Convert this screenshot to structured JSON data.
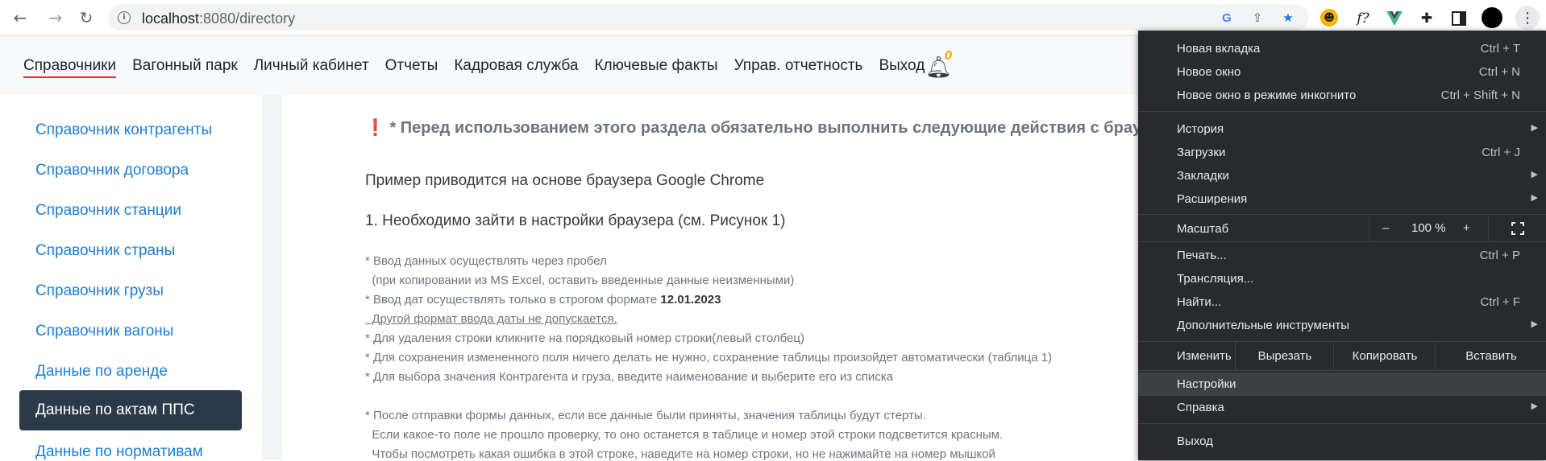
{
  "browser": {
    "url_host": "localhost",
    "url_path": ":8080/directory",
    "nav": {
      "back": "←",
      "forward": "→",
      "reload": "↻"
    },
    "omnibox_icons": [
      "google-icon",
      "share-icon",
      "star-icon"
    ],
    "extension_icons": [
      "ext-face-icon",
      "ext-function-icon",
      "ext-vue-icon",
      "puzzle-icon",
      "sidepanel-icon",
      "profile-avatar",
      "kebab-menu-icon"
    ],
    "ext_function_label": "f?"
  },
  "site": {
    "nav": [
      "Справочники",
      "Вагонный парк",
      "Личный кабинет",
      "Отчеты",
      "Кадровая служба",
      "Ключевые факты",
      "Управ. отчетность",
      "Выход"
    ],
    "active_nav": "Справочники",
    "notifications_count": "0"
  },
  "sidebar": {
    "items": [
      "Справочник контрагенты",
      "Справочник договора",
      "Справочник станции",
      "Справочник страны",
      "Справочник грузы",
      "Справочник вагоны",
      "Данные по аренде",
      "Данные по актам ППС",
      "Данные по нормативам"
    ],
    "active": "Данные по актам ППС"
  },
  "content": {
    "warning_mark": "❗",
    "warning": "* Перед использованием этого раздела обязательно выполнить следующие действия с браузером",
    "example": "Пример приводится на основе браузера Google Chrome",
    "step1": "1. Необходимо зайти в настройки браузера (см. Рисунок 1)",
    "notes": [
      "* Ввод данных осуществлять через пробел",
      "  (при копировании из MS Excel, оставить введенные данные неизменными)",
      "* Ввод дат осуществлять только в строгом формате ",
      "  Другой формат ввода даты не допускается.",
      "* Для удаления строки кликните на порядковый номер строки(левый столбец)",
      "* Для сохранения измененного поля ничего делать не нужно, сохранение таблицы произойдет автоматически (таблица 1)",
      "* Для выбора значения Контрагента и груза, введите наименование и выберите его из списка",
      "* После отправки формы данных, если все данные были приняты, значения таблицы будут стерты.",
      "  Если какое-то поле не прошло проверку, то оно останется в таблице и номер этой строки подсветится красным.",
      "  Чтобы посмотреть какая ошибка в этой строке, наведите на номер строки, но не нажимайте на номер мышкой"
    ],
    "date_format": "12.01.2023"
  },
  "menu": {
    "new_tab": {
      "label": "Новая вкладка",
      "shortcut": "Ctrl + T"
    },
    "new_window": {
      "label": "Новое окно",
      "shortcut": "Ctrl + N"
    },
    "incognito": {
      "label": "Новое окно в режиме инкогнито",
      "shortcut": "Ctrl + Shift + N"
    },
    "history": {
      "label": "История"
    },
    "downloads": {
      "label": "Загрузки",
      "shortcut": "Ctrl + J"
    },
    "bookmarks": {
      "label": "Закладки"
    },
    "extensions": {
      "label": "Расширения"
    },
    "zoom": {
      "label": "Масштаб",
      "minus": "–",
      "value": "100 %",
      "plus": "+"
    },
    "print": {
      "label": "Печать...",
      "shortcut": "Ctrl + P"
    },
    "cast": {
      "label": "Трансляция..."
    },
    "find": {
      "label": "Найти...",
      "shortcut": "Ctrl + F"
    },
    "more_tools": {
      "label": "Дополнительные инструменты"
    },
    "edit": {
      "label": "Изменить",
      "cut": "Вырезать",
      "copy": "Копировать",
      "paste": "Вставить"
    },
    "settings": {
      "label": "Настройки"
    },
    "help": {
      "label": "Справка"
    },
    "exit": {
      "label": "Выход"
    }
  }
}
